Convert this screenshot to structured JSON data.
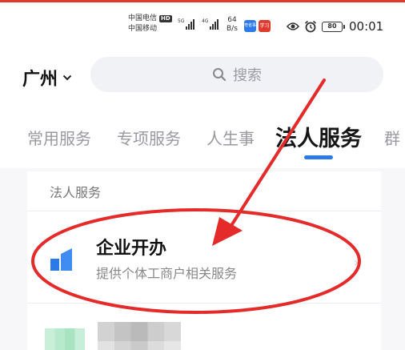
{
  "status_bar": {
    "carrier_1": "中国电信",
    "carrier_1_badge": "HD",
    "carrier_2": "中国移动",
    "signal_1_tag": "5G",
    "signal_2_tag": "4G",
    "net_speed_value": "64",
    "net_speed_unit": "B/s",
    "battery_level": "80",
    "time": "00:01",
    "app_icon_a": "粤省事",
    "app_icon_b": "学习"
  },
  "header": {
    "city": "广州",
    "city_icon": "chevron-down-icon",
    "search_placeholder": "搜索",
    "search_icon": "search-icon"
  },
  "tabs": [
    {
      "label": "常用服务",
      "active": false
    },
    {
      "label": "专项服务",
      "active": false
    },
    {
      "label": "人生事",
      "active": false
    },
    {
      "label": "法人服务",
      "active": true
    },
    {
      "label": "群",
      "active": false
    }
  ],
  "colors": {
    "accent": "#2c7ae8",
    "annotation": "#e52a2a",
    "top_line": "#e03a2f"
  },
  "section": {
    "title": "法人服务",
    "items": [
      {
        "title": "企业开办",
        "description": "提供个体工商户相关服务",
        "icon": "building-blocks-icon",
        "arrow": "›"
      }
    ]
  }
}
